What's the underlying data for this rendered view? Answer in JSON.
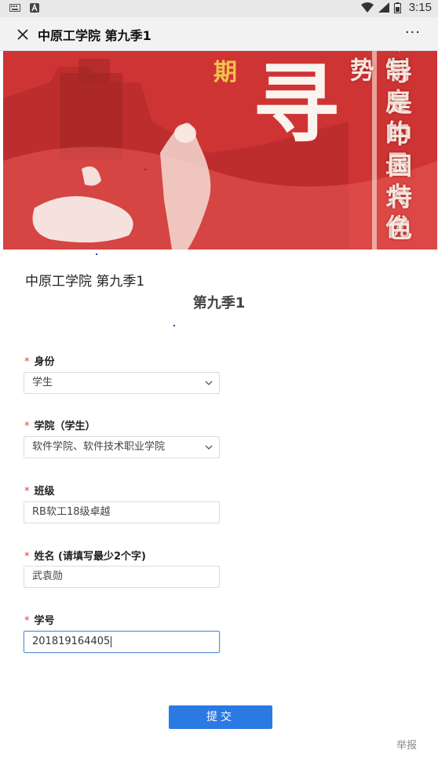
{
  "status_bar": {
    "time": "3:15"
  },
  "title_bar": {
    "title": "中原工学院 第九季1",
    "more_label": "···"
  },
  "banner": {
    "left_char": "期",
    "big_char": "寻",
    "col1": "制度的最大优势",
    "col2": "领导是中国特色"
  },
  "form": {
    "header": "中原工学院 第九季1",
    "subtitle": "第九季1",
    "required_mark": "*",
    "fields": [
      {
        "label": "身份",
        "value": "学生",
        "type": "select"
      },
      {
        "label": "学院（学生）",
        "value": "软件学院、软件技术职业学院",
        "type": "select"
      },
      {
        "label": "班级",
        "value": "RB软工18级卓越",
        "type": "text"
      },
      {
        "label": "姓名 (请填写最少2个字)",
        "value": "武袁勋",
        "type": "text"
      },
      {
        "label": "学号",
        "value": "201819164405",
        "type": "text"
      }
    ],
    "submit_label": "提交",
    "report_label": "举报"
  },
  "colors": {
    "accent": "#2b7ae4",
    "required": "#e0413c",
    "banner_red": "#d83a3a"
  }
}
